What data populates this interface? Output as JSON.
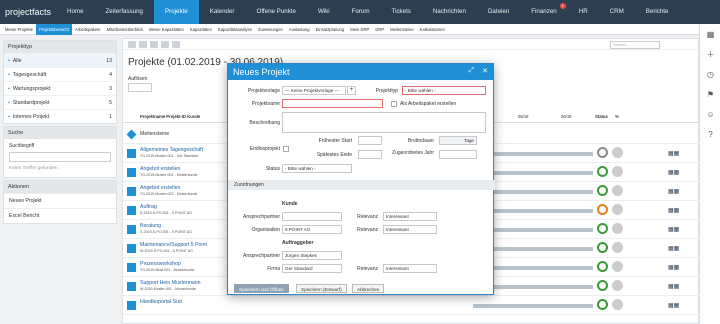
{
  "app": {
    "logo": "projectfacts"
  },
  "topnav": [
    "Home",
    "Zeiterfassung",
    "Projekte",
    "Kalender",
    "Offene Punkte",
    "Wiki",
    "Forum",
    "Tickets",
    "Nachrichten",
    "Dateien",
    "Finanzen",
    "HR",
    "CRM",
    "Berichte"
  ],
  "topnav_active": "Projekte",
  "finance_badge": "1",
  "subnav": [
    "Meine Projekte",
    "Projektübersicht",
    "Arbeitspakete",
    "Mitarbeiterüberblick",
    "Meine Kapazitäten",
    "Kapazitäten",
    "Kapazitätsanalyse",
    "Zuweisungen",
    "Auslastung",
    "Einsatzplanung",
    "Mein DRP",
    "DRP",
    "Meilensteine",
    "Kalkulationen"
  ],
  "subnav_active": "Projektübersicht",
  "left": {
    "projekttyp_header": "Projekttyp",
    "types": [
      {
        "label": "Alle",
        "count": "13"
      },
      {
        "label": "Tagesgeschäft",
        "count": "4"
      },
      {
        "label": "Wartungsprojekt",
        "count": "3"
      },
      {
        "label": "Standardprojekt",
        "count": "5"
      },
      {
        "label": "Internes Projekt",
        "count": "1"
      }
    ],
    "suche_header": "Suche",
    "suchbegriff": "Suchbegriff",
    "keine_treffer": "Keine Treffer gefunden",
    "aktionen_header": "Aktionen",
    "actions": [
      "Neues Projekt",
      "Excel Bericht"
    ]
  },
  "main": {
    "title": "Projekte (01.02.2019 - 30.06.2019)",
    "aufloesen": "Auflösen",
    "filter_placeholder": "Suchen",
    "col_projekt": "Projektname Projekt-ID Kunde",
    "col_date1": "05/19",
    "col_date2": "06/19",
    "col_status": "Status",
    "col_pct": "%",
    "rows": [
      {
        "name": "Meilensteine",
        "sub": ""
      },
      {
        "name": "Allgemeines Tagesgeschäft",
        "sub": "TG-2019-Muster-001 - Ger Standard"
      },
      {
        "name": "Angebot erstellen",
        "sub": "TG-2019-Muster-001 - Musterkunde"
      },
      {
        "name": "Angebot erstellen",
        "sub": "TG-2019-Muster-002 - Musterkunde"
      },
      {
        "name": "Auftrag",
        "sub": "S-2019-S-PO-001 - 5 POINT AG"
      },
      {
        "name": "Beratung",
        "sub": "S-2019-S-PO-001 - 5 POINT AG"
      },
      {
        "name": "Maintenance/Support 5 Point",
        "sub": "W-2019-S-PO-001 - 5 POINT AG"
      },
      {
        "name": "Prozessworkshop",
        "sub": "TG-2019-Must-001 - Musterkunde"
      },
      {
        "name": "Support Hein Mustermann",
        "sub": "W-2019-Muster-001 - Musterkunde"
      },
      {
        "name": "Händlerportal Süd",
        "sub": ""
      }
    ],
    "status_colors": [
      "#ffffff",
      "#888888",
      "#3a9a3a",
      "#3a9a3a",
      "#e67e22",
      "#3a9a3a",
      "#3a9a3a",
      "#3a9a3a",
      "#3a9a3a",
      "#3a9a3a"
    ]
  },
  "modal": {
    "title": "Neues Projekt",
    "projektvorlage_label": "Projektvorlage",
    "projektvorlage_value": "--- Keine Projektvorlage ---",
    "projekttyp_label": "Projekttyp",
    "projekttyp_value": "- Bitte wählen -",
    "projektname_label": "Projektname",
    "als_arbeitspaket": "Als Arbeitspaket erstellen",
    "beschreibung_label": "Beschreibung",
    "endlosprojekt_label": "Endlosprojekt",
    "fruehester_start": "Frühester Start",
    "spaetestes_ende": "Spätestes Ende",
    "bruttodauer": "Bruttodauer",
    "tage": "Tage",
    "zugeordnetes_jahr": "Zugeordnetes Jahr",
    "status_label": "Status",
    "status_value": "- Bitte wählen -",
    "zuordnungen": "Zuordnungen",
    "kunde_header": "Kunde",
    "ansprechpartner_label": "Ansprechpartner",
    "relevanz_label": "Relevanz",
    "relevanz_value": "Interessant",
    "organisation_label": "Organisation",
    "organisation_value": "5 POINT AG",
    "auftraggeber_header": "Auftraggeber",
    "ap2_value": "Jürgen Stepkes",
    "firma_label": "Firma",
    "firma_value": "Ger Standard",
    "btn_save_open": "Speichern und Öffnen",
    "btn_save_draft": "Speichern (Entwurf)",
    "btn_cancel": "Abbrechen"
  }
}
